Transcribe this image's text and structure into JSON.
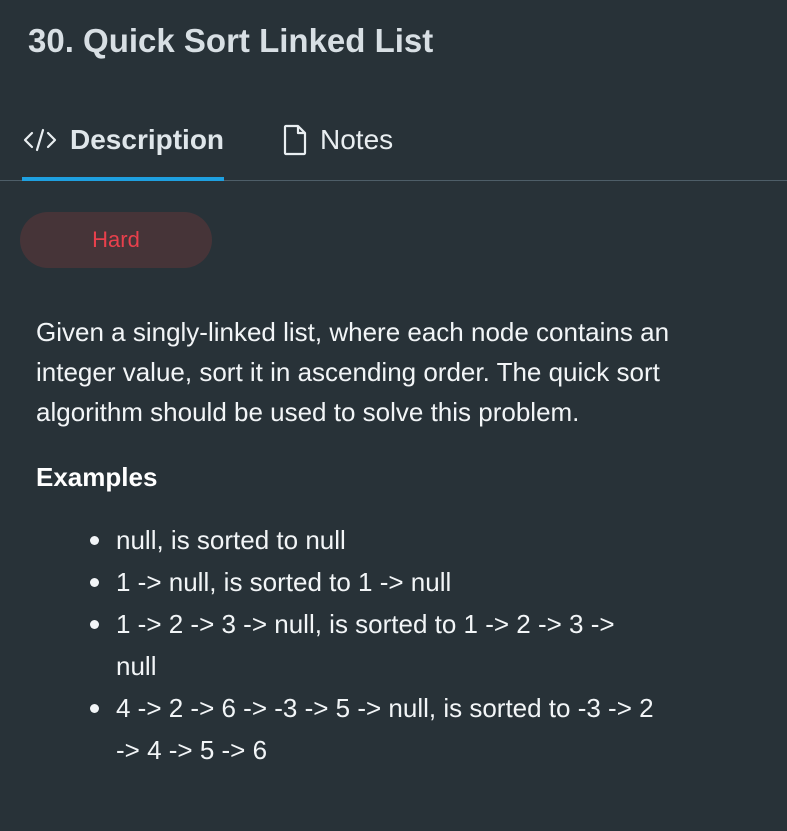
{
  "problem": {
    "title": "30. Quick Sort Linked List",
    "difficulty": "Hard"
  },
  "tabs": [
    {
      "label": "Description",
      "icon": "code-icon",
      "active": true
    },
    {
      "label": "Notes",
      "icon": "document-icon",
      "active": false
    }
  ],
  "description": "Given a singly-linked list, where each node contains an integer value, sort it in ascending order. The quick sort algorithm should be used to solve this problem.",
  "examples": {
    "heading": "Examples",
    "items": [
      "null, is sorted to null",
      "1 -> null, is sorted to 1 -> null",
      "1 -> 2 -> 3 -> null, is sorted to 1 -> 2 -> 3 -> null",
      "4 -> 2 -> 6 -> -3 -> 5 -> null, is sorted to -3 -> 2 -> 4 -> 5 -> 6"
    ]
  },
  "colors": {
    "background": "#283238",
    "accent": "#1ea0e0",
    "hard": "#e8404c"
  }
}
